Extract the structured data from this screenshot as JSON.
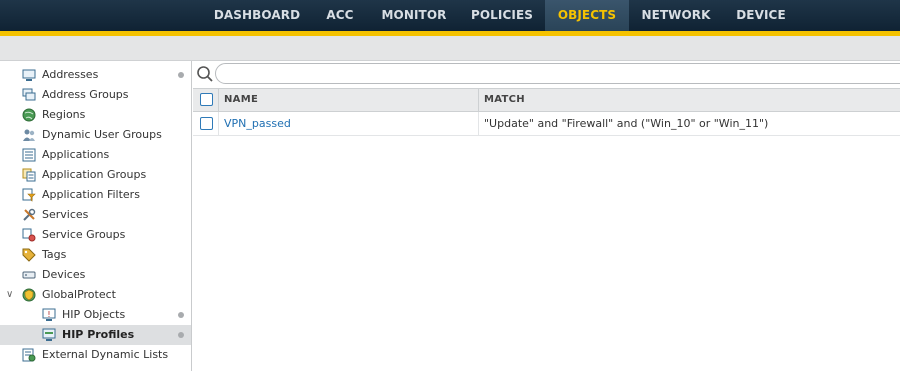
{
  "nav": {
    "tabs": [
      {
        "label": "DASHBOARD"
      },
      {
        "label": "ACC"
      },
      {
        "label": "MONITOR"
      },
      {
        "label": "POLICIES"
      },
      {
        "label": "OBJECTS"
      },
      {
        "label": "NETWORK"
      },
      {
        "label": "DEVICE"
      }
    ],
    "active_tab": "OBJECTS",
    "accent_color": "#f5c200"
  },
  "sidebar": {
    "items": [
      {
        "label": "Addresses",
        "icon": "address-icon",
        "dot": true
      },
      {
        "label": "Address Groups",
        "icon": "address-group-icon",
        "dot": false
      },
      {
        "label": "Regions",
        "icon": "globe-icon",
        "dot": false
      },
      {
        "label": "Dynamic User Groups",
        "icon": "user-group-icon",
        "dot": false
      },
      {
        "label": "Applications",
        "icon": "applications-icon",
        "dot": false
      },
      {
        "label": "Application Groups",
        "icon": "application-group-icon",
        "dot": false
      },
      {
        "label": "Application Filters",
        "icon": "filter-icon",
        "dot": false
      },
      {
        "label": "Services",
        "icon": "tools-icon",
        "dot": false
      },
      {
        "label": "Service Groups",
        "icon": "service-group-icon",
        "dot": false
      },
      {
        "label": "Tags",
        "icon": "tag-icon",
        "dot": false
      },
      {
        "label": "Devices",
        "icon": "device-icon",
        "dot": false
      },
      {
        "label": "GlobalProtect",
        "icon": "globalprotect-icon",
        "dot": false
      },
      {
        "label": "HIP Objects",
        "icon": "hip-object-icon",
        "dot": true
      },
      {
        "label": "HIP Profiles",
        "icon": "hip-profile-icon",
        "dot": true
      },
      {
        "label": "External Dynamic Lists",
        "icon": "dynamic-list-icon",
        "dot": false
      }
    ],
    "selected": "HIP Profiles"
  },
  "search": {
    "placeholder": "",
    "value": ""
  },
  "table": {
    "columns": [
      "NAME",
      "MATCH"
    ],
    "rows": [
      {
        "name": "VPN_passed",
        "match": "\"Update\" and \"Firewall\" and (\"Win_10\" or \"Win_11\")"
      }
    ]
  }
}
